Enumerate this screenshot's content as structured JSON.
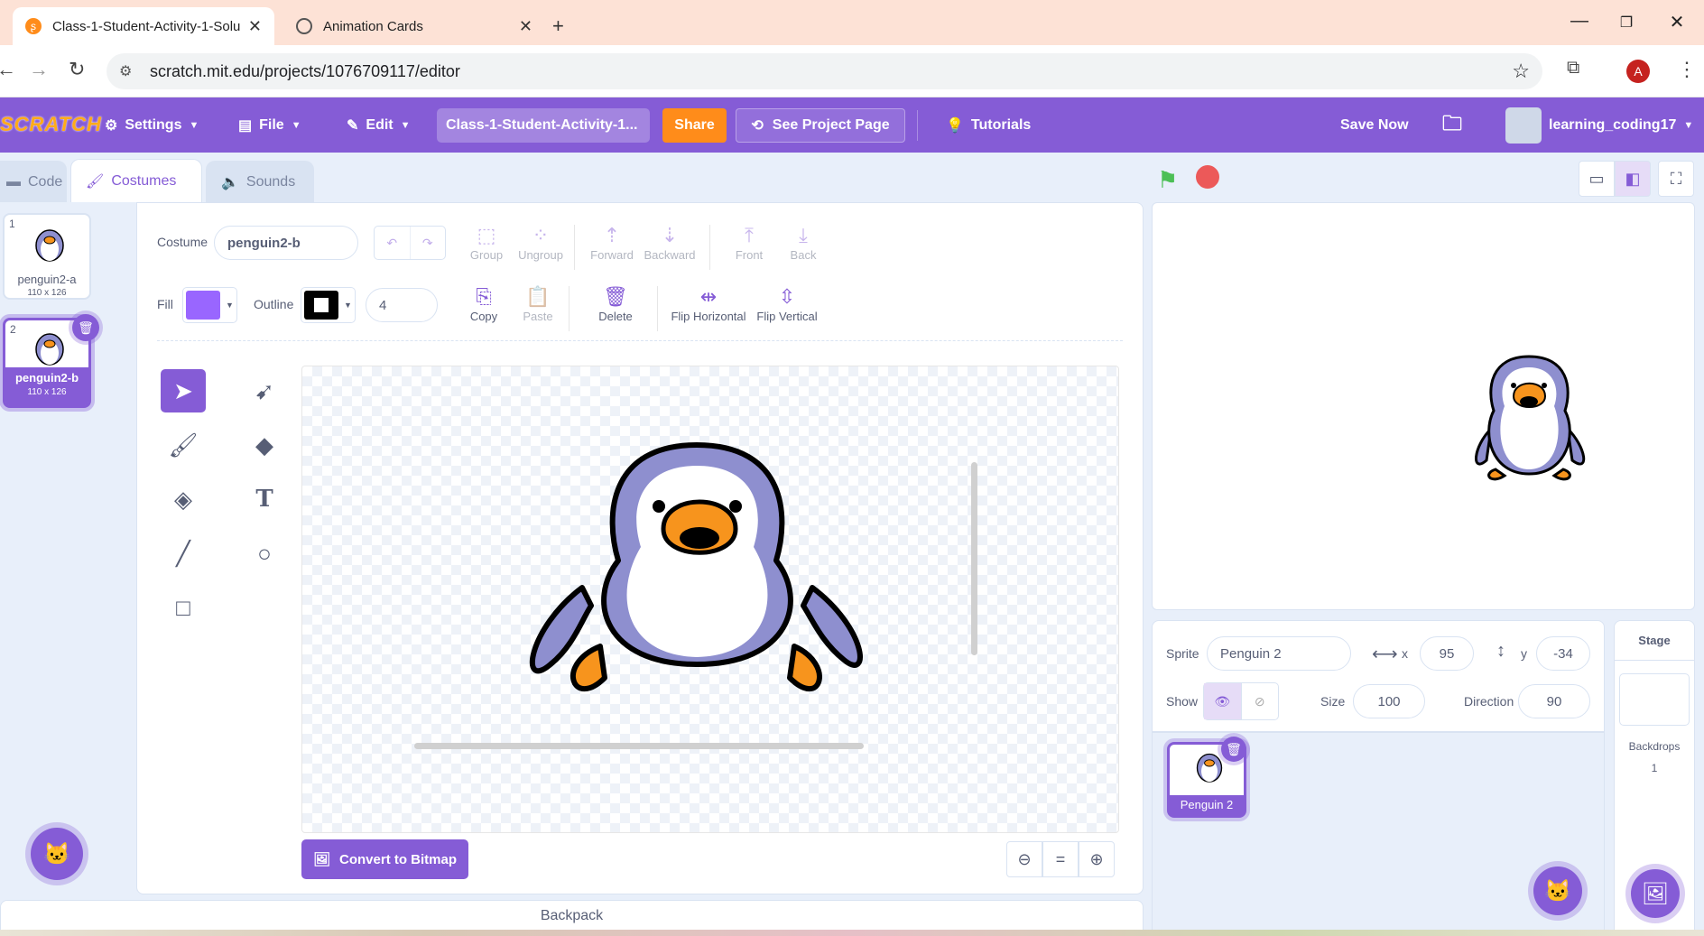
{
  "browser": {
    "tabs": [
      {
        "title": "Class-1-Student-Activity-1-Solu",
        "active": true
      },
      {
        "title": "Animation Cards",
        "active": false
      }
    ],
    "new_tab": "+",
    "url": "scratch.mit.edu/projects/1076709117/editor",
    "profile_initial": "A"
  },
  "menu": {
    "logo": "SCRATCH",
    "settings": "Settings",
    "file": "File",
    "edit": "Edit",
    "project_title": "Class-1-Student-Activity-1...",
    "share": "Share",
    "see_project": "See Project Page",
    "tutorials": "Tutorials",
    "save_now": "Save Now",
    "username": "learning_coding17"
  },
  "editor_tabs": {
    "code": "Code",
    "costumes": "Costumes",
    "sounds": "Sounds"
  },
  "costumes": [
    {
      "num": "1",
      "name": "penguin2-a",
      "size": "110 x 126",
      "selected": false
    },
    {
      "num": "2",
      "name": "penguin2-b",
      "size": "110 x 126",
      "selected": true
    }
  ],
  "paint": {
    "costume_label": "Costume",
    "costume_name": "penguin2-b",
    "fill_label": "Fill",
    "fill_color": "#9966ff",
    "outline_label": "Outline",
    "outline_color": "#000000",
    "outline_width": "4",
    "tools_row1": {
      "group": "Group",
      "ungroup": "Ungroup",
      "forward": "Forward",
      "backward": "Backward",
      "front": "Front",
      "back": "Back"
    },
    "tools_row2": {
      "copy": "Copy",
      "paste": "Paste",
      "delete": "Delete",
      "flip_h": "Flip Horizontal",
      "flip_v": "Flip Vertical"
    },
    "convert": "Convert to Bitmap",
    "zoom_reset": "="
  },
  "backpack": "Backpack",
  "sprite": {
    "label": "Sprite",
    "name": "Penguin 2",
    "x_label": "x",
    "x": "95",
    "y_label": "y",
    "y": "-34",
    "show_label": "Show",
    "size_label": "Size",
    "size": "100",
    "direction_label": "Direction",
    "direction": "90",
    "card_name": "Penguin 2"
  },
  "stage_panel": {
    "title": "Stage",
    "backdrops_label": "Backdrops",
    "backdrops_count": "1"
  },
  "colors": {
    "accent": "#855cd6",
    "share": "#ff8c1a",
    "flag": "#4cbf56",
    "stop": "#ec5959"
  }
}
